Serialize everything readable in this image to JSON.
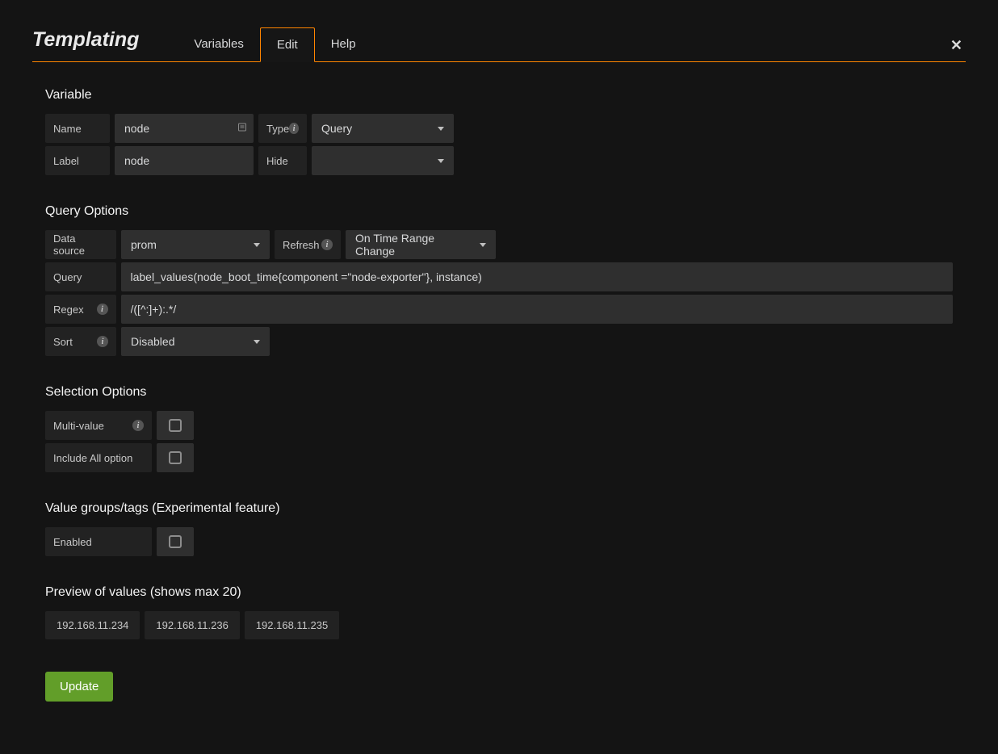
{
  "header": {
    "title": "Templating",
    "tabs": {
      "variables": "Variables",
      "edit": "Edit",
      "help": "Help"
    }
  },
  "variable": {
    "heading": "Variable",
    "name_label": "Name",
    "name_value": "node",
    "label_label": "Label",
    "label_value": "node",
    "type_label": "Type",
    "type_value": "Query",
    "hide_label": "Hide",
    "hide_value": ""
  },
  "query": {
    "heading": "Query Options",
    "data_source_label": "Data source",
    "data_source_value": "prom",
    "refresh_label": "Refresh",
    "refresh_value": "On Time Range Change",
    "query_label": "Query",
    "query_value": "label_values(node_boot_time{component =\"node-exporter\"}, instance)",
    "regex_label": "Regex",
    "regex_value": "/([^:]+):.*/",
    "sort_label": "Sort",
    "sort_value": "Disabled"
  },
  "selection": {
    "heading": "Selection Options",
    "multi_label": "Multi-value",
    "include_label": "Include All option"
  },
  "tags": {
    "heading": "Value groups/tags (Experimental feature)",
    "enabled_label": "Enabled"
  },
  "preview": {
    "heading": "Preview of values (shows max 20)",
    "values": [
      "192.168.11.234",
      "192.168.11.236",
      "192.168.11.235"
    ]
  },
  "actions": {
    "update": "Update"
  }
}
